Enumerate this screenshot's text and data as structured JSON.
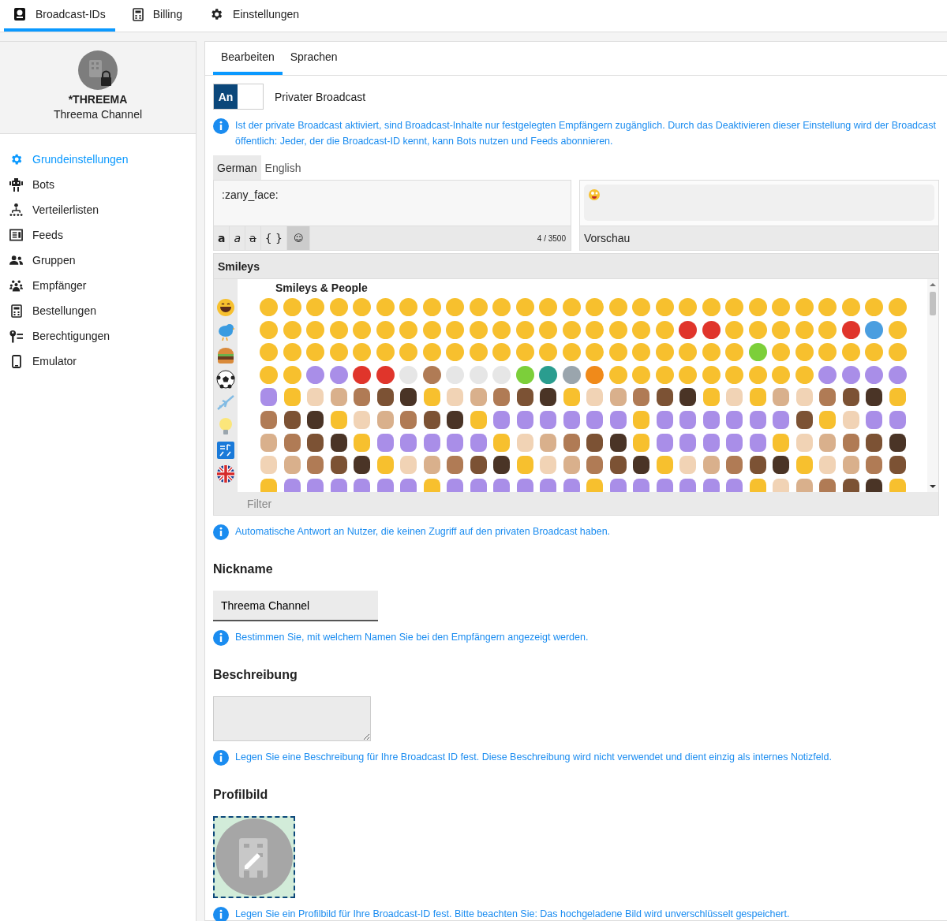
{
  "top_nav": [
    {
      "label": "Broadcast-IDs",
      "selected": true,
      "kind": "id"
    },
    {
      "label": "Billing",
      "selected": false,
      "kind": "billing"
    },
    {
      "label": "Einstellungen",
      "selected": false,
      "kind": "settings"
    }
  ],
  "sidebar": {
    "title": "*THREEMA",
    "subtitle": "Threema Channel",
    "items": [
      {
        "label": "Grundeinstellungen",
        "selected": true,
        "kind": "gear"
      },
      {
        "label": "Bots",
        "selected": false,
        "kind": "robot"
      },
      {
        "label": "Verteilerlisten",
        "selected": false,
        "kind": "tree"
      },
      {
        "label": "Feeds",
        "selected": false,
        "kind": "feed"
      },
      {
        "label": "Gruppen",
        "selected": false,
        "kind": "group"
      },
      {
        "label": "Empfänger",
        "selected": false,
        "kind": "people"
      },
      {
        "label": "Bestellungen",
        "selected": false,
        "kind": "billing"
      },
      {
        "label": "Berechtigungen",
        "selected": false,
        "kind": "key"
      },
      {
        "label": "Emulator",
        "selected": false,
        "kind": "phone"
      }
    ]
  },
  "tabs": [
    {
      "label": "Bearbeiten",
      "selected": true
    },
    {
      "label": "Sprachen",
      "selected": false
    }
  ],
  "private_toggle": {
    "state_label": "An",
    "on": true,
    "label": "Privater Broadcast"
  },
  "private_info": "Ist der private Broadcast aktiviert, sind Broadcast-Inhalte nur festgelegten Empfängern zugänglich. Durch das Deaktivieren dieser Einstellung wird der Broadcast öffentlich: Jeder, der die Broadcast-ID kennt, kann Bots nutzen und Feeds abonnieren.",
  "language_tabs": [
    {
      "label": "German",
      "selected": true
    },
    {
      "label": "English",
      "selected": false
    }
  ],
  "editor": {
    "value": ":zany_face:",
    "format_buttons": [
      {
        "kind": "bold",
        "label": "a",
        "selected": false
      },
      {
        "kind": "italic",
        "label": "a",
        "selected": false
      },
      {
        "kind": "strike",
        "label": "a",
        "selected": false
      },
      {
        "kind": "code",
        "label": "{ }",
        "selected": false
      },
      {
        "kind": "emoji",
        "label": "☺",
        "selected": true
      }
    ],
    "counter": "4 / 3500"
  },
  "preview": {
    "label": "Vorschau"
  },
  "emoji_picker": {
    "title": "Smileys",
    "section": "Smileys & People",
    "filter_placeholder": "Filter"
  },
  "auto_reply_info": "Automatische Antwort an Nutzer, die keinen Zugriff auf den privaten Broadcast haben.",
  "nickname": {
    "heading": "Nickname",
    "value": "Threema Channel",
    "info": "Bestimmen Sie, mit welchem Namen Sie bei den Empfängern angezeigt werden."
  },
  "description": {
    "heading": "Beschreibung",
    "info": "Legen Sie eine Beschreibung für Ihre Broadcast ID fest. Diese Beschreibung wird nicht verwendet und dient einzig als internes Notizfeld."
  },
  "profile_picture": {
    "heading": "Profilbild",
    "info": "Legen Sie ein Profilbild für Ihre Broadcast-ID fest. Bitte beachten Sie: Das hochgeladene Bild wird unverschlüsselt gespeichert."
  }
}
